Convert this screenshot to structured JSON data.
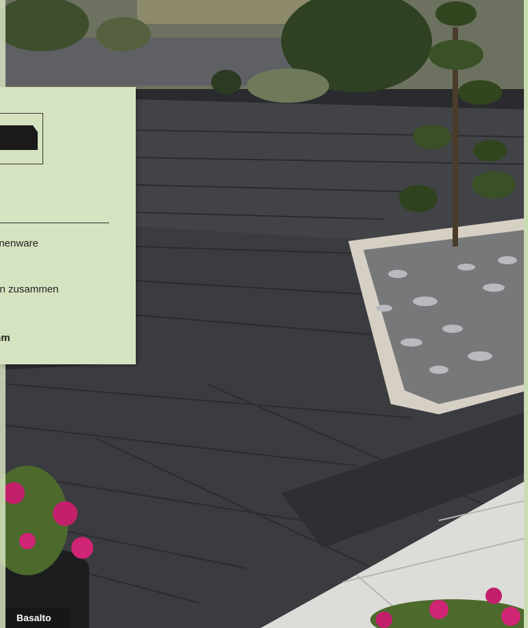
{
  "info_panel": {
    "lines": [
      "nnenware",
      "",
      "ten zusammen",
      "mm"
    ]
  },
  "caption": {
    "label": "Basalto"
  },
  "colors": {
    "panel": "#d6e3c0",
    "paving": "#3b3c40",
    "light_paving": "#dcdcd8",
    "border_stone": "#cfc8bd",
    "badge": "#161618"
  },
  "icons": {
    "paver_profile": "paver-profile-icon"
  }
}
